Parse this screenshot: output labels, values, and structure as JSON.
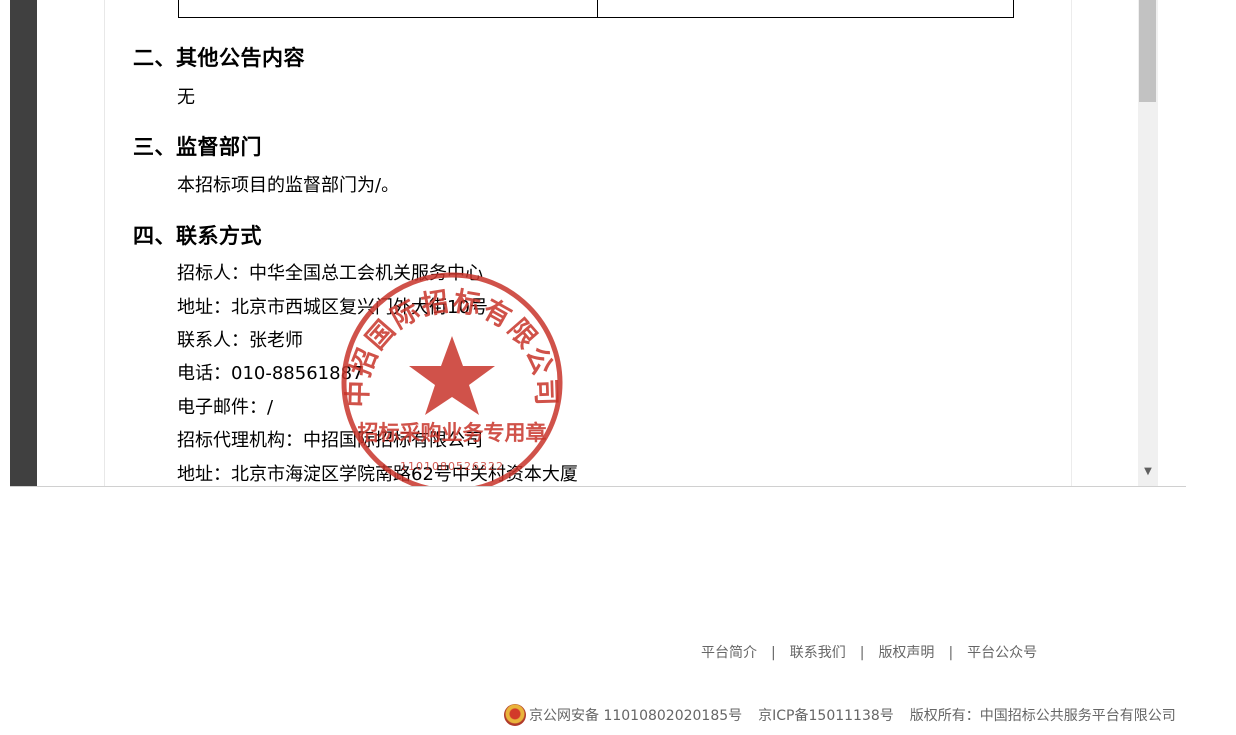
{
  "document": {
    "section2": {
      "heading": "二、其他公告内容",
      "body": "无"
    },
    "section3": {
      "heading": "三、监督部门",
      "body": "本招标项目的监督部门为/。"
    },
    "section4": {
      "heading": "四、联系方式",
      "lines": [
        "招标人：中华全国总工会机关服务中心",
        "地址：北京市西城区复兴门外大街10号",
        "联系人：张老师",
        "电话：010-88561887",
        "电子邮件：/",
        "招标代理机构：中招国际招标有限公司",
        "地址：北京市海淀区学院南路62号中关村资本大厦"
      ]
    },
    "stamp": {
      "outer_text": "中招国际招标有限公司",
      "inner_text": "招标采购业务专用章",
      "code": "1101080526322"
    }
  },
  "viewer": {
    "scroll_down_glyph": "▼"
  },
  "footer": {
    "links": [
      "平台简介",
      "联系我们",
      "版权声明",
      "平台公众号"
    ],
    "separator": "|",
    "police_record": "京公网安备 11010802020185号",
    "icp_record": "京ICP备15011138号",
    "copyright": "版权所有：中国招标公共服务平台有限公司"
  },
  "colors": {
    "stamp_red": "#c8342a",
    "footer_text": "#666666",
    "viewer_dark": "#3a3a3a"
  }
}
